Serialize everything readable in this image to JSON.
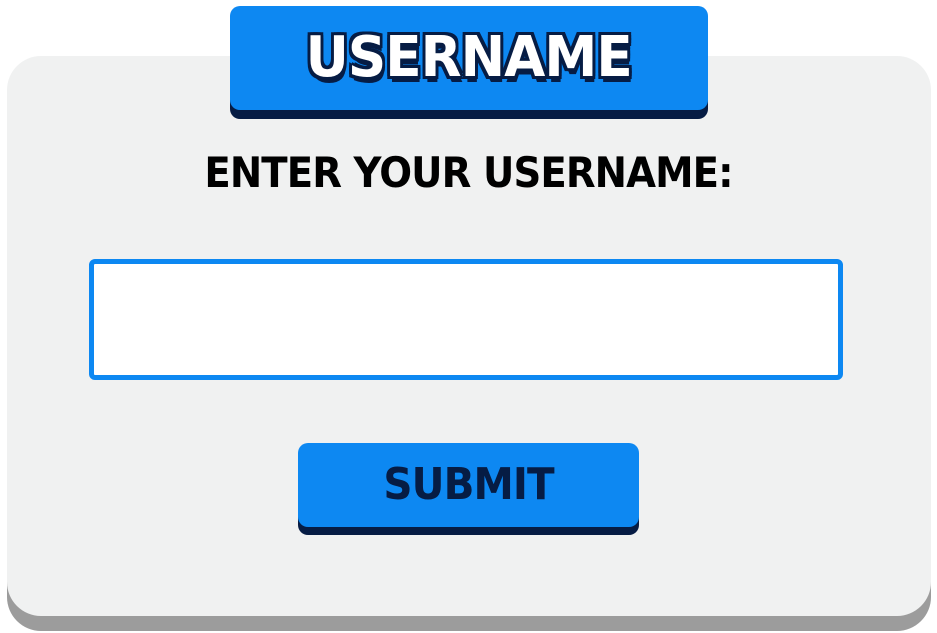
{
  "dialog": {
    "title": "USERNAME",
    "prompt": "ENTER YOUR USERNAME:",
    "username_value": "",
    "username_placeholder": "",
    "submit_label": "SUBMIT"
  },
  "colors": {
    "accent": "#0d88f2",
    "dark_navy": "#061c44",
    "panel_bg": "#f0f1f1",
    "panel_shadow": "#9c9c9c",
    "input_bg": "#ffffff"
  }
}
